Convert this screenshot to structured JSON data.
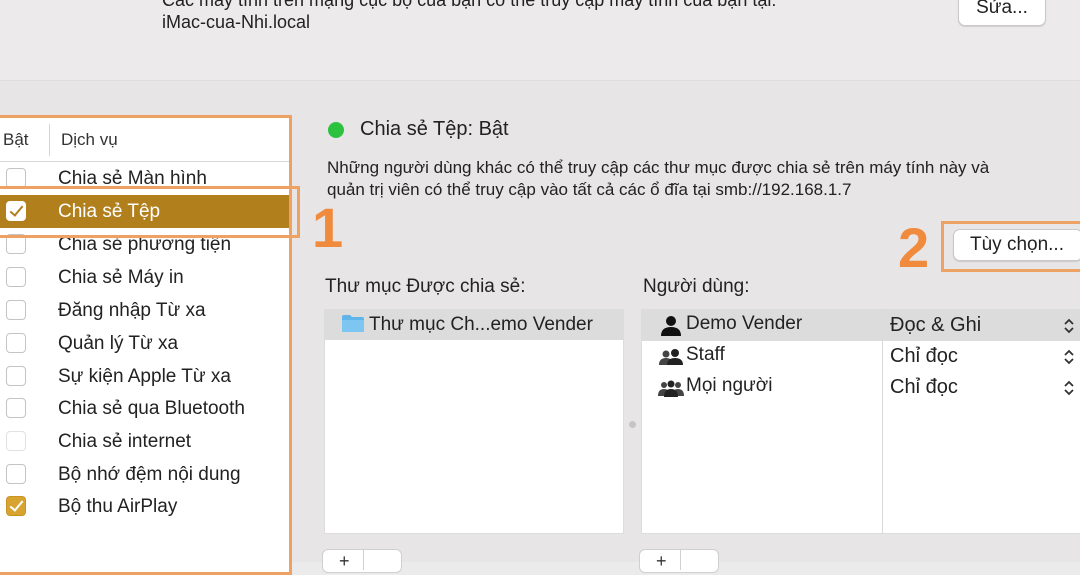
{
  "top": {
    "clipped_text": "Các máy tính trên mạng cục bộ của bạn có thể truy cập máy tính của bạn tại:",
    "computer_address": "iMac-cua-Nhi.local",
    "edit_label": "Sửa..."
  },
  "services": {
    "col_on": "Bật",
    "col_service": "Dịch vụ",
    "items": [
      {
        "label": "Chia sẻ Màn hình",
        "checked": false,
        "selected": false
      },
      {
        "label": "Chia sẻ Tệp",
        "checked": true,
        "selected": true
      },
      {
        "label": "Chia sẻ phương tiện",
        "checked": false,
        "selected": false
      },
      {
        "label": "Chia sẻ Máy in",
        "checked": false,
        "selected": false
      },
      {
        "label": "Đăng nhập Từ xa",
        "checked": false,
        "selected": false
      },
      {
        "label": "Quản lý Từ xa",
        "checked": false,
        "selected": false
      },
      {
        "label": "Sự kiện Apple Từ xa",
        "checked": false,
        "selected": false
      },
      {
        "label": "Chia sẻ qua Bluetooth",
        "checked": false,
        "selected": false
      },
      {
        "label": "Chia sẻ internet",
        "checked": false,
        "selected": false
      },
      {
        "label": "Bộ nhớ đệm nội dung",
        "checked": false,
        "selected": false
      },
      {
        "label": "Bộ thu AirPlay",
        "checked": true,
        "selected": false
      }
    ]
  },
  "annotations": {
    "step1": "1",
    "step2": "2",
    "highlight_color": "#eda163",
    "number_color": "#f08a3c"
  },
  "detail": {
    "status_title": "Chia sẻ Tệp: Bật",
    "status_color": "#2cc13f",
    "desc_line1": "Những người dùng khác có thể truy cập các thư mục được chia sẻ trên máy tính này và",
    "desc_line2": "quản trị viên có thể truy cập vào tất cả các ổ đĩa tại smb://192.168.1.7",
    "options_label": "Tùy chọn...",
    "folders_label": "Thư mục Được chia sẻ:",
    "users_label": "Người dùng:",
    "folders": [
      "Thư mục Ch...emo Vender"
    ],
    "users": [
      {
        "name": "Demo Vender",
        "permission": "Đọc & Ghi",
        "icon": "single-user-icon",
        "selected": true
      },
      {
        "name": "Staff",
        "permission": "Chỉ đọc",
        "icon": "group-icon",
        "selected": false
      },
      {
        "name": "Mọi người",
        "permission": "Chỉ đọc",
        "icon": "everyone-icon",
        "selected": false
      }
    ],
    "add_symbol": "+"
  },
  "colors": {
    "selection": "#b27f1d",
    "checkbox_on": "#d8a431"
  }
}
